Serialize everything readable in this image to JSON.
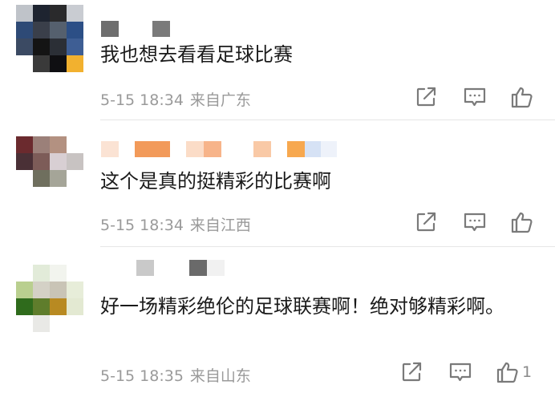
{
  "comments": [
    {
      "text": "我也想去看看足球比赛",
      "date": "5-15 18:34",
      "location": "来自广东",
      "like_count": ""
    },
    {
      "text": "这个是真的挺精彩的比赛啊",
      "date": "5-15 18:34",
      "location": "来自江西",
      "like_count": ""
    },
    {
      "text": "好一场精彩绝伦的足球联赛啊！绝对够精彩啊。",
      "date": "5-15 18:35",
      "location": "来自山东",
      "like_count": "1"
    }
  ],
  "icons": {
    "share": "share-icon",
    "comment": "comment-icon",
    "like": "thumbs-up-icon"
  },
  "colors": {
    "text": "#1a1a1a",
    "meta": "#9a9a9a",
    "icon": "#7a7a7a",
    "divider": "#e6e6e6"
  }
}
